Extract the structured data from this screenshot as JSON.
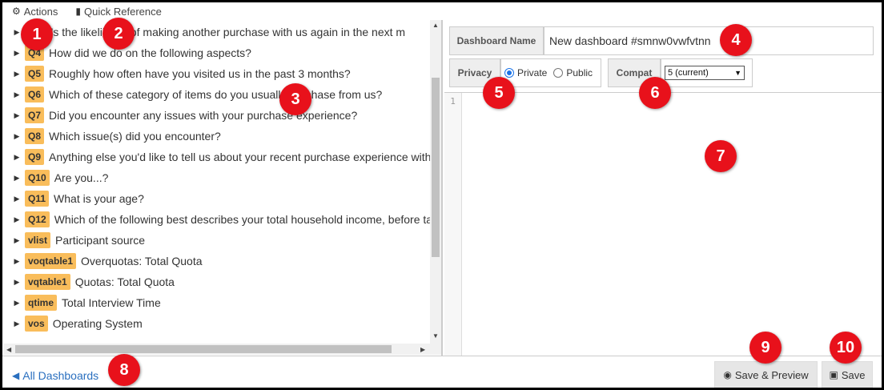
{
  "topbar": {
    "actions_label": "Actions",
    "quick_reference_label": "Quick Reference"
  },
  "questions": [
    {
      "badge": "",
      "text": "What's the likelihood of making another purchase with us again in the next m"
    },
    {
      "badge": "Q4",
      "text": "How did we do on the following aspects?"
    },
    {
      "badge": "Q5",
      "text": "Roughly how often have you visited us in the past 3 months?"
    },
    {
      "badge": "Q6",
      "text": "Which of these category of items do you usually purchase from us?"
    },
    {
      "badge": "Q7",
      "text": "Did you encounter any issues with your purchase experience?"
    },
    {
      "badge": "Q8",
      "text": "Which issue(s) did you encounter?"
    },
    {
      "badge": "Q9",
      "text": "Anything else you'd like to tell us about your recent purchase experience with"
    },
    {
      "badge": "Q10",
      "text": "Are you...?"
    },
    {
      "badge": "Q11",
      "text": "What is your age?"
    },
    {
      "badge": "Q12",
      "text": "Which of the following best describes your total household income, before ta"
    },
    {
      "badge": "vlist",
      "text": "Participant source"
    },
    {
      "badge": "voqtable1",
      "text": "Overquotas: Total Quota"
    },
    {
      "badge": "vqtable1",
      "text": "Quotas: Total Quota"
    },
    {
      "badge": "qtime",
      "text": "Total Interview Time"
    },
    {
      "badge": "vos",
      "text": "Operating System"
    }
  ],
  "form": {
    "name_label": "Dashboard Name",
    "name_value": "New dashboard #smnw0vwfvtnn",
    "privacy_label": "Privacy",
    "private_option": "Private",
    "public_option": "Public",
    "privacy_selected": "Private",
    "compat_label": "Compat",
    "compat_value": "5 (current)"
  },
  "editor": {
    "line_number": "1",
    "content": ""
  },
  "bottom": {
    "all_dashboards_label": "All Dashboards",
    "save_preview_label": "Save & Preview",
    "save_label": "Save"
  },
  "markers": [
    "1",
    "2",
    "3",
    "4",
    "5",
    "6",
    "7",
    "8",
    "9",
    "10"
  ],
  "colors": {
    "badge": "#f9bd5b",
    "marker": "#e8111b",
    "link": "#2a6fbf"
  }
}
